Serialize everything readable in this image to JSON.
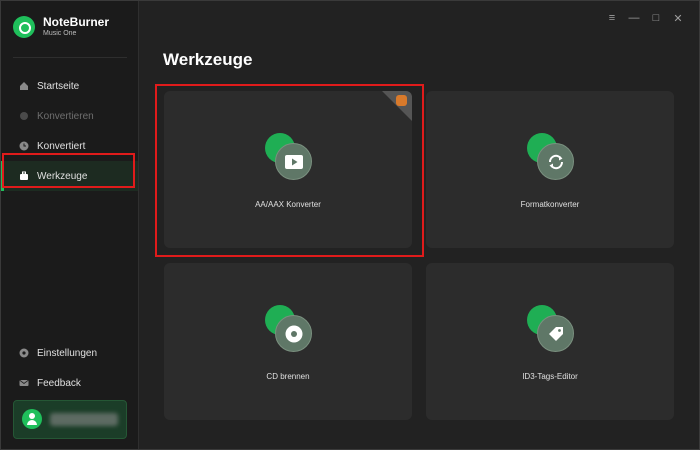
{
  "brand": {
    "name": "NoteBurner",
    "subtitle": "Music One"
  },
  "window_controls": [
    {
      "name": "menu-icon",
      "glyph": "≡"
    },
    {
      "name": "minimize-icon",
      "glyph": "—"
    },
    {
      "name": "maximize-icon",
      "glyph": "□"
    },
    {
      "name": "close-icon",
      "glyph": "✕"
    }
  ],
  "sidebar": {
    "items": [
      {
        "label": "Startseite",
        "icon": "home-icon",
        "state": "normal"
      },
      {
        "label": "Konvertieren",
        "icon": "convert-icon",
        "state": "disabled"
      },
      {
        "label": "Konvertiert",
        "icon": "clock-icon",
        "state": "normal"
      },
      {
        "label": "Werkzeuge",
        "icon": "toolbox-icon",
        "state": "active"
      }
    ],
    "bottom_items": [
      {
        "label": "Einstellungen",
        "icon": "settings-icon"
      },
      {
        "label": "Feedback",
        "icon": "mail-icon"
      }
    ]
  },
  "main": {
    "title": "Werkzeuge",
    "cards": [
      {
        "label": "AA/AAX Konverter",
        "icon": "play-video-icon"
      },
      {
        "label": "Formatkonverter",
        "icon": "refresh-icon"
      },
      {
        "label": "CD brennen",
        "icon": "disc-icon"
      },
      {
        "label": "ID3-Tags-Editor",
        "icon": "tag-icon"
      }
    ]
  },
  "colors": {
    "accent": "#1fbf5b",
    "highlight": "#e01b1b",
    "background": "#222222",
    "sidebar": "#1b1b1b",
    "card": "#2c2c2c"
  }
}
